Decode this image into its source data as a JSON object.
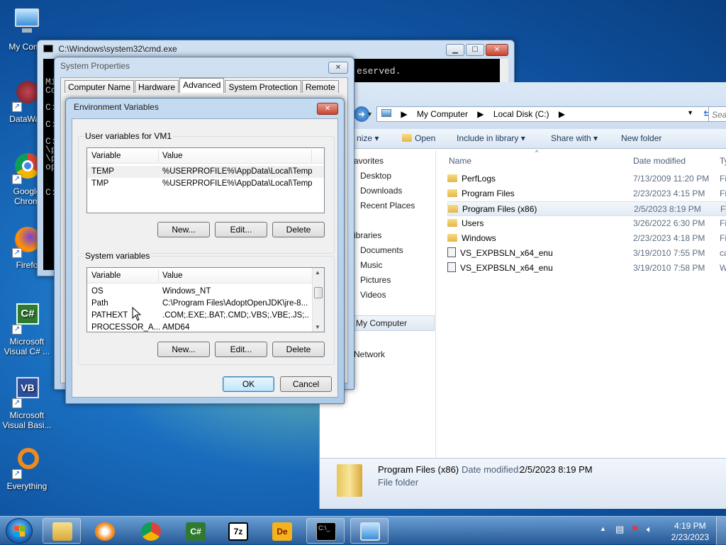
{
  "desktop": {
    "icons": [
      {
        "label": "My Comp"
      },
      {
        "label": "DataWag"
      },
      {
        "label": "Google Chrom"
      },
      {
        "label": "Firefo"
      },
      {
        "label": "Microsoft Visual C# ..."
      },
      {
        "label": "Microsoft Visual Basi..."
      },
      {
        "label": "Everything"
      }
    ]
  },
  "cmd": {
    "title": "C:\\Windows\\system32\\cmd.exe",
    "lines": [
      "Mi",
      "Co",
      "",
      "C:",
      "",
      "C:",
      "",
      "C:",
      "\\p",
      "\\p",
      "op",
      "",
      "",
      "C:"
    ],
    "reserved_text": "eserved."
  },
  "explorer": {
    "breadcrumb": [
      "My Computer",
      "Local Disk (C:)"
    ],
    "search_placeholder": "Sea",
    "toolbar": {
      "organize": "nize",
      "open": "Open",
      "include": "Include in library",
      "share": "Share with",
      "new_folder": "New folder"
    },
    "nav": {
      "favorites": "avorites",
      "desktop": "Desktop",
      "downloads": "Downloads",
      "recent": "Recent Places",
      "libraries": "ibraries",
      "documents": "Documents",
      "music": "Music",
      "pictures": "Pictures",
      "videos": "Videos",
      "my_computer": "My Computer",
      "network": "Network"
    },
    "columns": {
      "name": "Name",
      "date": "Date modified",
      "type": "Ty"
    },
    "files": [
      {
        "name": "PerfLogs",
        "date": "7/13/2009 11:20 PM",
        "type": "Fi"
      },
      {
        "name": "Program Files",
        "date": "2/23/2023 4:15 PM",
        "type": "Fi"
      },
      {
        "name": "Program Files (x86)",
        "date": "2/5/2023 8:19 PM",
        "type": "Fi"
      },
      {
        "name": "Users",
        "date": "3/26/2022 6:30 PM",
        "type": "Fi"
      },
      {
        "name": "Windows",
        "date": "2/23/2023 4:18 PM",
        "type": "Fi"
      },
      {
        "name": "VS_EXPBSLN_x64_enu",
        "date": "3/19/2010 7:55 PM",
        "type": "ca"
      },
      {
        "name": "VS_EXPBSLN_x64_enu",
        "date": "3/19/2010 7:58 PM",
        "type": "W"
      }
    ],
    "details": {
      "name": "Program Files (x86)",
      "date_label": "Date modified:",
      "date_value": "2/5/2023 8:19 PM",
      "kind": "File folder"
    }
  },
  "sysprops": {
    "title": "System Properties",
    "tabs": [
      "Computer Name",
      "Hardware",
      "Advanced",
      "System Protection",
      "Remote"
    ]
  },
  "envvars": {
    "title": "Environment Variables",
    "user_group": "User variables for VM1",
    "system_group": "System variables",
    "col_variable": "Variable",
    "col_value": "Value",
    "user_vars": [
      {
        "name": "TEMP",
        "value": "%USERPROFILE%\\AppData\\Local\\Temp"
      },
      {
        "name": "TMP",
        "value": "%USERPROFILE%\\AppData\\Local\\Temp"
      }
    ],
    "system_vars": [
      {
        "name": "OS",
        "value": "Windows_NT"
      },
      {
        "name": "Path",
        "value": "C:\\Program Files\\AdoptOpenJDK\\jre-8...."
      },
      {
        "name": "PATHEXT",
        "value": ".COM;.EXE;.BAT;.CMD;.VBS;.VBE;.JS;...."
      },
      {
        "name": "PROCESSOR_A...",
        "value": "AMD64"
      }
    ],
    "btn_new": "New...",
    "btn_edit": "Edit...",
    "btn_delete": "Delete",
    "btn_ok": "OK",
    "btn_cancel": "Cancel"
  },
  "taskbar": {
    "time": "4:19 PM",
    "date": "2/23/2023"
  },
  "colors": {
    "accent": "#3c7fb1",
    "wallpaper": "#1a6fc0"
  }
}
